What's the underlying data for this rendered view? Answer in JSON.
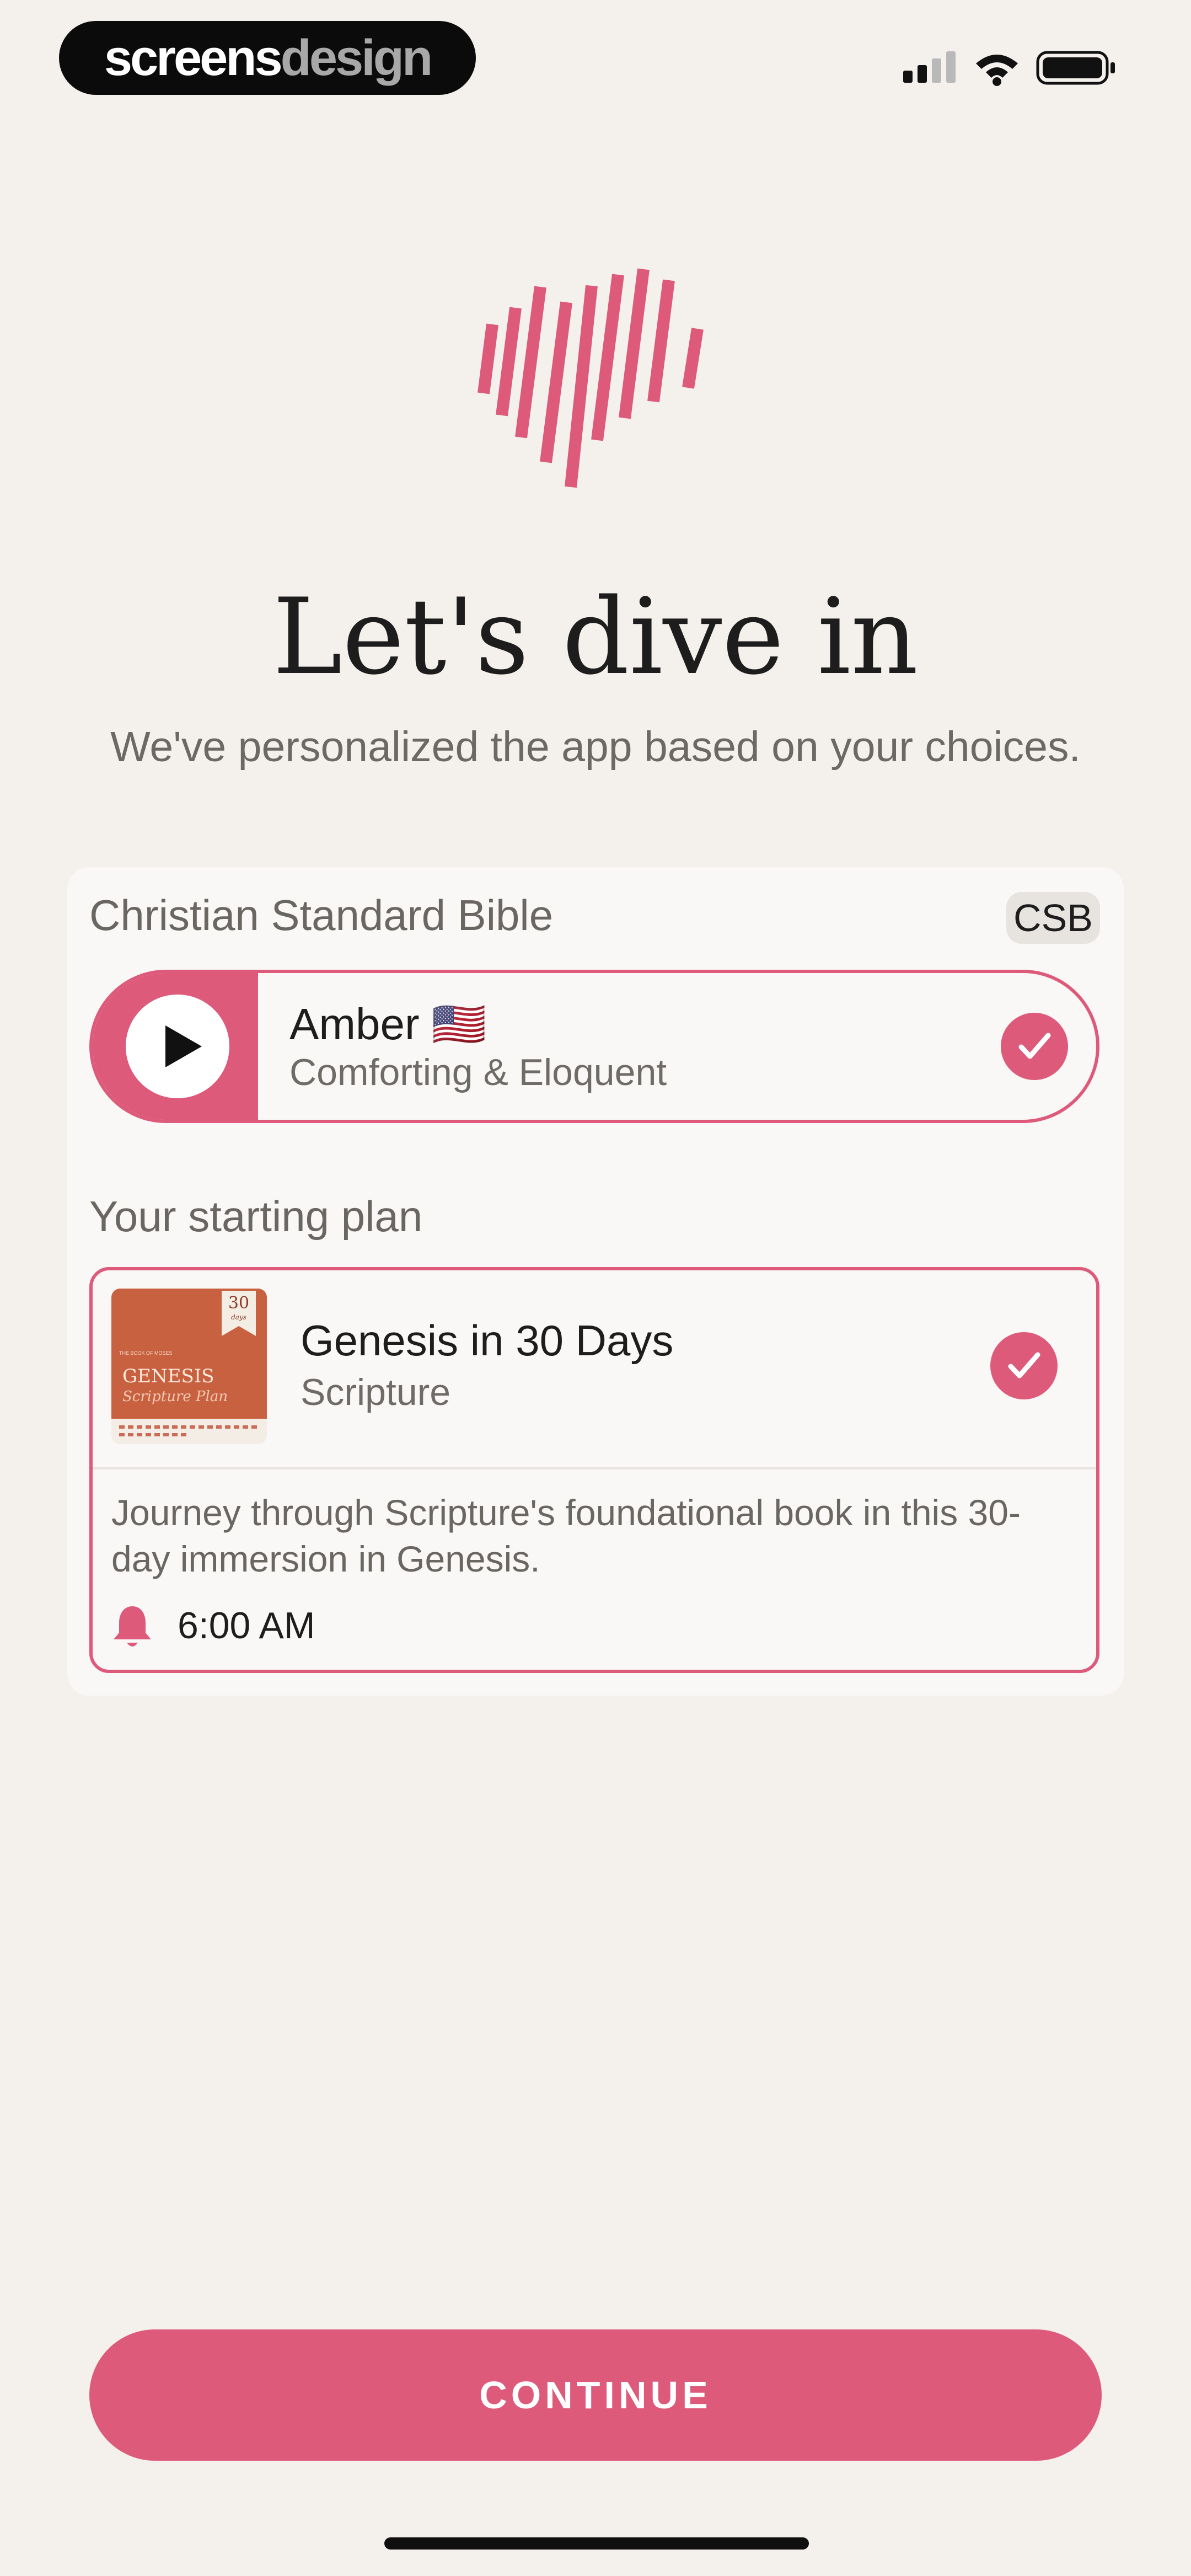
{
  "status_bar": {
    "brand_part1": "screens",
    "brand_part2": "design",
    "icons": [
      "cellular-signal-icon",
      "wifi-icon",
      "battery-icon"
    ]
  },
  "header": {
    "title": "Let's dive in",
    "subtitle": "We've personalized the app based on your choices."
  },
  "bible": {
    "name": "Christian Standard Bible",
    "badge": "CSB"
  },
  "voice": {
    "name": "Amber 🇺🇸",
    "description": "Comforting & Eloquent",
    "selected": true
  },
  "plan_section": {
    "label": "Your starting plan",
    "cover": {
      "top_text": "THE BOOK OF MOSES",
      "number": "30",
      "number_sub": "days",
      "title": "GENESIS",
      "subtitle": "Scripture Plan"
    },
    "title": "Genesis in 30 Days",
    "type": "Scripture",
    "description": "Journey through Scripture's foundational book in this 30-day immersion in Genesis.",
    "reminder_time": "6:00 AM",
    "selected": true
  },
  "continue_label": "CONTINUE",
  "colors": {
    "accent": "#dd5a7b",
    "background": "#f4f1ec",
    "card": "#faf8f6",
    "book_cover": "#c8613f"
  }
}
